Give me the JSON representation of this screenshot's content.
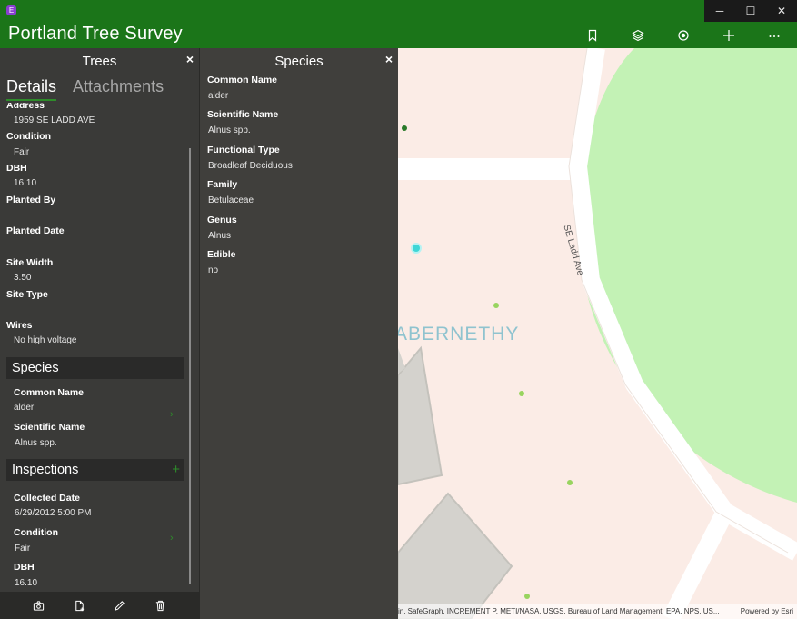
{
  "app": {
    "title": "Portland Tree Survey",
    "icon_letter": "E",
    "accent": "#1b7519"
  },
  "window_controls": {
    "minimize": "─",
    "maximize": "☐",
    "close": "✕"
  },
  "toolbar": {
    "icons": [
      "bookmark-icon",
      "layers-icon",
      "location-icon",
      "add-icon",
      "more-icon"
    ],
    "more_label": "···",
    "add_label": "+"
  },
  "trees_panel": {
    "title": "Trees",
    "close": "×",
    "tabs": [
      {
        "label": "Details",
        "active": true
      },
      {
        "label": "Attachments",
        "active": false
      }
    ],
    "fields": [
      {
        "label": "Address",
        "value": "1959 SE LADD AVE"
      },
      {
        "label": "Condition",
        "value": "Fair"
      },
      {
        "label": "DBH",
        "value": "16.10"
      },
      {
        "label": "Planted By",
        "value": ""
      },
      {
        "label": "Planted Date",
        "value": ""
      },
      {
        "label": "Site Width",
        "value": "3.50"
      },
      {
        "label": "Site Type",
        "value": ""
      },
      {
        "label": "Wires",
        "value": "No high voltage"
      }
    ],
    "species_section": {
      "title": "Species",
      "fields": [
        {
          "label": "Common Name",
          "value": "alder"
        },
        {
          "label": "Scientific Name",
          "value": "Alnus spp."
        }
      ]
    },
    "inspections_section": {
      "title": "Inspections",
      "plus": "+",
      "fields": [
        {
          "label": "Collected Date",
          "value": "6/29/2012 5:00 PM"
        },
        {
          "label": "Condition",
          "value": "Fair"
        },
        {
          "label": "DBH",
          "value": "16.10"
        }
      ]
    },
    "bottom_actions": [
      "camera-icon",
      "add-file-icon",
      "edit-icon",
      "delete-icon"
    ]
  },
  "species_panel": {
    "title": "Species",
    "close": "×",
    "fields": [
      {
        "label": "Common Name",
        "value": "alder"
      },
      {
        "label": "Scientific Name",
        "value": "Alnus spp."
      },
      {
        "label": "Functional Type",
        "value": "Broadleaf Deciduous"
      },
      {
        "label": "Family",
        "value": "Betulaceae"
      },
      {
        "label": "Genus",
        "value": "Alnus"
      },
      {
        "label": "Edible",
        "value": "no"
      }
    ]
  },
  "map": {
    "area_label": "ABERNETHY",
    "street_label": "SE Ladd Ave",
    "attribution": "in, SafeGraph, INCREMENT P, METI/NASA, USGS, Bureau of Land Management, EPA, NPS, US...",
    "powered_by": "Powered by Esri",
    "colors": {
      "park": "#c3f2b5",
      "road": "#ffffff",
      "building": "#d4d2cd",
      "tree_point": "#98d45f",
      "selected": "#3fd6d6"
    }
  }
}
